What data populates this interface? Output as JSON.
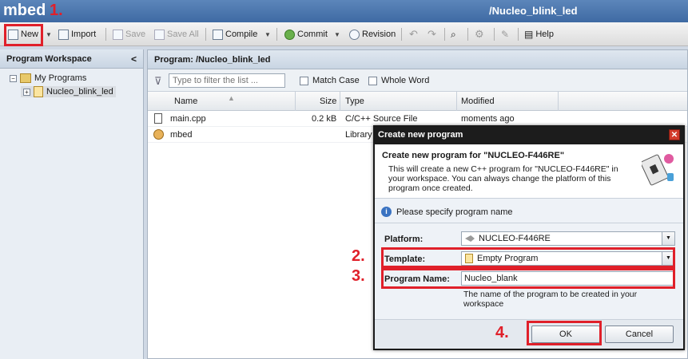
{
  "app": {
    "brand": "mbed",
    "project_path": "/Nucleo_blink_led"
  },
  "steps": [
    "1.",
    "2.",
    "3.",
    "4."
  ],
  "toolbar": {
    "new_label": "New",
    "import_label": "Import",
    "save_label": "Save",
    "save_all_label": "Save All",
    "compile_label": "Compile",
    "commit_label": "Commit",
    "revision_label": "Revision",
    "help_label": "Help"
  },
  "workspace": {
    "title": "Program Workspace",
    "collapse_glyph": "<",
    "tree": [
      {
        "label": "My Programs",
        "expand": "−"
      },
      {
        "label": "Nucleo_blink_led",
        "expand": "+"
      }
    ]
  },
  "program": {
    "title": "Program: /Nucleo_blink_led",
    "filter_placeholder": "Type to filter the list ...",
    "match_case_label": "Match Case",
    "whole_word_label": "Whole Word",
    "columns": [
      "Name",
      "Size",
      "Type",
      "Modified"
    ],
    "files": [
      {
        "name": "main.cpp",
        "size": "0.2 kB",
        "type": "C/C++ Source File",
        "modified": "moments ago"
      },
      {
        "name": "mbed",
        "size": "",
        "type": "Library",
        "modified": ""
      }
    ]
  },
  "dialog": {
    "title": "Create new program",
    "heading": "Create new program for \"NUCLEO-F446RE\"",
    "description": "This will create a new C++ program for \"NUCLEO-F446RE\" in your workspace. You can always change the platform of this program once created.",
    "info": "Please specify program name",
    "platform_label": "Platform:",
    "platform_value": "NUCLEO-F446RE",
    "template_label": "Template:",
    "template_value": "Empty Program",
    "program_name_label": "Program Name:",
    "program_name_value": "Nucleo_blank",
    "hint": "The name of the program to be created in your workspace",
    "ok_label": "OK",
    "cancel_label": "Cancel",
    "close_glyph": "✕"
  },
  "colors": {
    "title_bar": "#4a76ad",
    "highlight": "#e0202a",
    "dialog_titlebar": "#1c1c1c"
  }
}
